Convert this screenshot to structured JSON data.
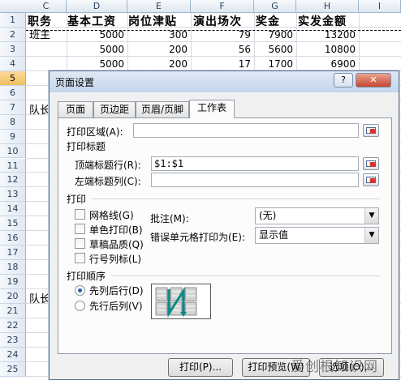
{
  "sheet": {
    "columns": [
      "C",
      "D",
      "E",
      "F",
      "G",
      "H",
      "I"
    ],
    "rows": [
      "1",
      "2",
      "3",
      "4",
      "5",
      "6",
      "7",
      "8",
      "9",
      "10",
      "11",
      "12",
      "13",
      "14",
      "15",
      "16",
      "17",
      "18",
      "19",
      "20",
      "21",
      "22",
      "23",
      "24",
      "25"
    ],
    "header_cells": [
      "职务",
      "基本工资",
      "岗位津贴",
      "演出场次",
      "奖金",
      "实发金额"
    ],
    "data_rows": [
      [
        "班主",
        "5000",
        "300",
        "79",
        "7900",
        "13200"
      ],
      [
        "",
        "5000",
        "200",
        "56",
        "5600",
        "10800"
      ],
      [
        "",
        "5000",
        "200",
        "17",
        "1700",
        "6900"
      ]
    ],
    "side_labels": {
      "row7": "队长",
      "row20": "队长"
    }
  },
  "dialog": {
    "title": "页面设置",
    "help_label": "?",
    "close_label": "✕",
    "tabs": [
      "页面",
      "页边距",
      "页眉/页脚",
      "工作表"
    ],
    "active_tab": "工作表",
    "print_area_label": "打印区域(A):",
    "print_area_value": "",
    "print_titles_label": "打印标题",
    "top_rows_label": "顶端标题行(R):",
    "top_rows_value": "$1:$1",
    "left_cols_label": "左端标题列(C):",
    "left_cols_value": "",
    "print_section_label": "打印",
    "checkboxes": [
      "网格线(G)",
      "单色打印(B)",
      "草稿品质(Q)",
      "行号列标(L)"
    ],
    "comments_label": "批注(M):",
    "comments_value": "(无)",
    "cell_errors_label": "错误单元格打印为(E):",
    "cell_errors_value": "显示值",
    "order_label": "打印顺序",
    "radio_down_over": "先列后行(D)",
    "radio_over_down": "先行后列(V)",
    "print_button": "打印(P)...",
    "preview_button": "打印预览(W)",
    "options_button": "选项(O)...",
    "watermark": "爱创根知识网"
  },
  "colors": {
    "accent": "#2b5ea8",
    "selected_row_header": "#f1c15f",
    "close_button": "#c7472e"
  }
}
